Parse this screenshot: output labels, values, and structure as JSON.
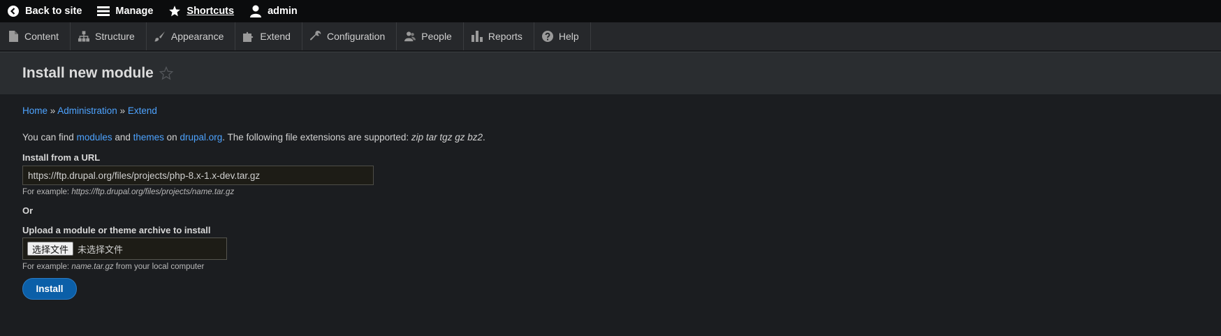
{
  "toolbar": {
    "back_to_site": "Back to site",
    "manage": "Manage",
    "shortcuts": "Shortcuts",
    "user": "admin"
  },
  "tray": {
    "items": [
      {
        "label": "Content",
        "icon": "page-icon"
      },
      {
        "label": "Structure",
        "icon": "sitemap-icon"
      },
      {
        "label": "Appearance",
        "icon": "brush-icon"
      },
      {
        "label": "Extend",
        "icon": "puzzle-icon"
      },
      {
        "label": "Configuration",
        "icon": "wrench-icon"
      },
      {
        "label": "People",
        "icon": "people-icon"
      },
      {
        "label": "Reports",
        "icon": "bar-chart-icon"
      },
      {
        "label": "Help",
        "icon": "help-icon"
      }
    ]
  },
  "page": {
    "title": "Install new module"
  },
  "breadcrumb": {
    "home": "Home",
    "sep1": " » ",
    "administration": "Administration",
    "sep2": " » ",
    "extend": "Extend"
  },
  "intro": {
    "t1": "You can find ",
    "modules": "modules",
    "t2": " and ",
    "themes": "themes",
    "t3": " on ",
    "drupal": "drupal.org",
    "t4": ". The following file extensions are supported: ",
    "exts": "zip tar tgz gz bz2",
    "t5": "."
  },
  "url_field": {
    "label": "Install from a URL",
    "value": "https://ftp.drupal.org/files/projects/php-8.x-1.x-dev.tar.gz",
    "desc_prefix": "For example: ",
    "desc_example": "https://ftp.drupal.org/files/projects/name.tar.gz"
  },
  "or_label": "Or",
  "upload_field": {
    "label": "Upload a module or theme archive to install",
    "button": "选择文件",
    "status": "未选择文件",
    "desc_prefix": "For example: ",
    "desc_example": "name.tar.gz",
    "desc_suffix": " from your local computer"
  },
  "install_button": "Install",
  "colors": {
    "toolbar_bg": "#0b0c0d",
    "tray_bg": "#26282b",
    "link": "#4da3ff",
    "primary_button": "#0b5fa8"
  }
}
